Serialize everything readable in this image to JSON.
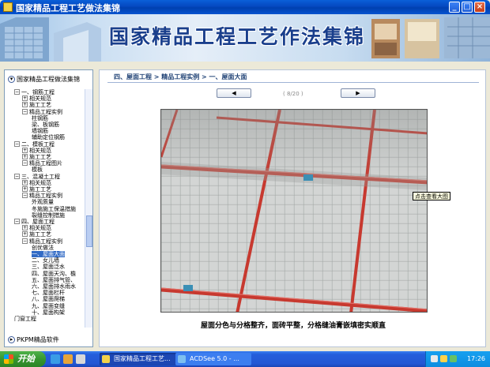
{
  "window": {
    "title": "国家精品工程工艺做法集锦",
    "buttons": {
      "minimize": "_",
      "maximize": "□",
      "close": "×"
    }
  },
  "banner": {
    "title": "国家精品工程工艺作法集锦"
  },
  "sidebar": {
    "header": "国家精品工程做法集锦",
    "footer": "PKPM精品软件",
    "tree": [
      {
        "label": "一、钢筋工程",
        "pm": "−",
        "level": 0
      },
      {
        "label": "相关规范",
        "pm": "+",
        "level": 1
      },
      {
        "label": "施工工艺",
        "pm": "+",
        "level": 1
      },
      {
        "label": "精品工程实例",
        "pm": "−",
        "level": 1
      },
      {
        "label": "柱钢筋",
        "pm": "",
        "level": 2
      },
      {
        "label": "梁、板钢筋",
        "pm": "",
        "level": 2
      },
      {
        "label": "墙钢筋",
        "pm": "",
        "level": 2
      },
      {
        "label": "辅助定位钢筋",
        "pm": "",
        "level": 2
      },
      {
        "label": "二、模板工程",
        "pm": "−",
        "level": 0
      },
      {
        "label": "相关规范",
        "pm": "+",
        "level": 1
      },
      {
        "label": "施工工艺",
        "pm": "+",
        "level": 1
      },
      {
        "label": "精品工程图片",
        "pm": "−",
        "level": 1
      },
      {
        "label": "模板",
        "pm": "",
        "level": 2
      },
      {
        "label": "三、混凝土工程",
        "pm": "−",
        "level": 0
      },
      {
        "label": "相关规范",
        "pm": "+",
        "level": 1
      },
      {
        "label": "施工工艺",
        "pm": "+",
        "level": 1
      },
      {
        "label": "精品工程实例",
        "pm": "−",
        "level": 1
      },
      {
        "label": "外观质量",
        "pm": "",
        "level": 2
      },
      {
        "label": "冬施施工保温措施",
        "pm": "",
        "level": 2
      },
      {
        "label": "裂缝控制措施",
        "pm": "",
        "level": 2
      },
      {
        "label": "四、屋面工程",
        "pm": "−",
        "level": 0
      },
      {
        "label": "相关规范",
        "pm": "+",
        "level": 1
      },
      {
        "label": "施工工艺",
        "pm": "+",
        "level": 1
      },
      {
        "label": "精品工程实例",
        "pm": "−",
        "level": 1
      },
      {
        "label": "创优做法",
        "pm": "",
        "level": 2
      },
      {
        "label": "一、屋面大面",
        "pm": "",
        "level": 2,
        "selected": true
      },
      {
        "label": "二、女儿墙",
        "pm": "",
        "level": 2
      },
      {
        "label": "三、屋面泛水",
        "pm": "",
        "level": 2
      },
      {
        "label": "四、屋面天沟、檐",
        "pm": "",
        "level": 2
      },
      {
        "label": "五、屋面排气管、",
        "pm": "",
        "level": 2
      },
      {
        "label": "六、屋面排水雨水",
        "pm": "",
        "level": 2
      },
      {
        "label": "七、屋面栏杆",
        "pm": "",
        "level": 2
      },
      {
        "label": "八、屋面爬梯",
        "pm": "",
        "level": 2
      },
      {
        "label": "九、屋面变缝",
        "pm": "",
        "level": 2
      },
      {
        "label": "十、屋面构架",
        "pm": "",
        "level": 2
      },
      {
        "label": "门窗工程",
        "pm": "",
        "level": 0
      }
    ]
  },
  "main": {
    "breadcrumb": "四、屋面工程 > 精品工程实例 > 一、屋面大面",
    "prev_label": "◀",
    "next_label": "▶",
    "pager": "( 8/20 )",
    "tooltip": "点击查看大图",
    "caption": "屋面分色与分格整齐，面砖平整，分格缝油膏嵌填密实顺直"
  },
  "taskbar": {
    "start_label": "开始",
    "tasks": [
      {
        "label": "国家精品工程工艺..."
      },
      {
        "label": "ACDSee 5.0 - ..."
      }
    ],
    "clock": "17:26"
  },
  "colors": {
    "title_bar": "#0548c0",
    "taskbar": "#245edb",
    "start": "#36962f",
    "tile": "#c9cccb",
    "joint_red": "#c7392f"
  }
}
